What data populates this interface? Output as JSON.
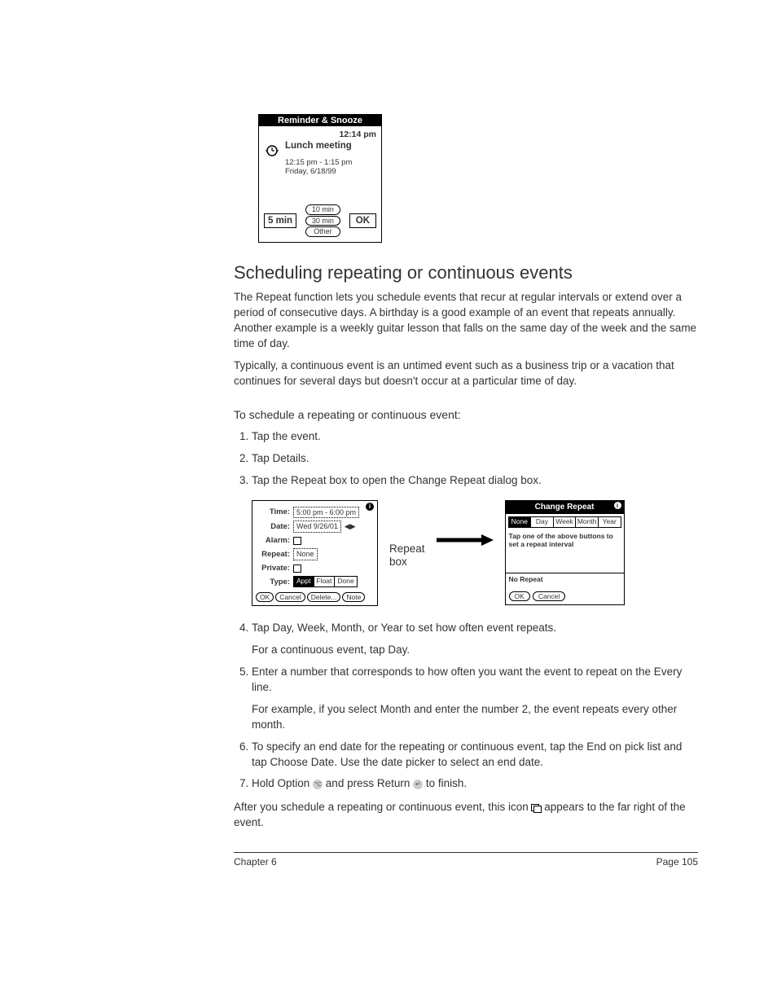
{
  "reminder_fig": {
    "header": "Reminder & Snooze",
    "current_time": "12:14 pm",
    "title": "Lunch meeting",
    "time_range": "12:15 pm - 1:15 pm",
    "date": "Friday, 6/18/99",
    "left_btn": "5 min",
    "mid_btns": [
      "10 min",
      "30 min",
      "Other"
    ],
    "ok_btn": "OK"
  },
  "heading": "Scheduling repeating or continuous events",
  "para1": "The Repeat function lets you schedule events that recur at regular intervals or extend over a period of consecutive days. A birthday is a good example of an event that repeats annually. Another example is a weekly guitar lesson that falls on the same day of the week and the same time of day.",
  "para2": "Typically, a continuous event is an untimed event such as a business trip or a vacation that continues for several days but doesn't occur at a particular time of day.",
  "subhead": "To schedule a repeating or continuous event:",
  "steps": {
    "s1": "Tap the event.",
    "s2": "Tap Details.",
    "s3": "Tap the Repeat box to open the Change Repeat dialog box.",
    "s4": "Tap Day, Week, Month, or Year to set how often event repeats.",
    "s4b": "For a continuous event, tap Day.",
    "s5": "Enter a number that corresponds to how often you want the event to repeat on the Every line.",
    "s5b": "For example, if you select Month and enter the number 2, the event repeats every other month.",
    "s6": "To specify an end date for the repeating or continuous event, tap the End on pick list and tap Choose Date. Use the date picker to select an end date.",
    "s7a": "Hold Option ",
    "s7b": " and press Return ",
    "s7c": " to finish."
  },
  "details_panel": {
    "labels": {
      "time": "Time:",
      "date": "Date:",
      "alarm": "Alarm:",
      "repeat": "Repeat:",
      "private": "Private:",
      "type": "Type:"
    },
    "time_val": "5:00 pm - 6:00 pm",
    "date_val": "Wed 9/26/01",
    "repeat_val": "None",
    "types": [
      "Appt",
      "Float",
      "Done"
    ],
    "buttons": [
      "OK",
      "Cancel",
      "Delete...",
      "Note"
    ]
  },
  "repeat_label": "Repeat\nbox",
  "change_panel": {
    "header": "Change Repeat",
    "tabs": [
      "None",
      "Day",
      "Week",
      "Month",
      "Year"
    ],
    "text": "Tap one of the above buttons to set a repeat interval",
    "norepeat": "No Repeat",
    "buttons": [
      "OK",
      "Cancel"
    ]
  },
  "closing_a": "After you schedule a repeating or continuous event, this icon ",
  "closing_b": " appears to the far right of the event.",
  "footer": {
    "left": "Chapter 6",
    "right": "Page 105"
  }
}
